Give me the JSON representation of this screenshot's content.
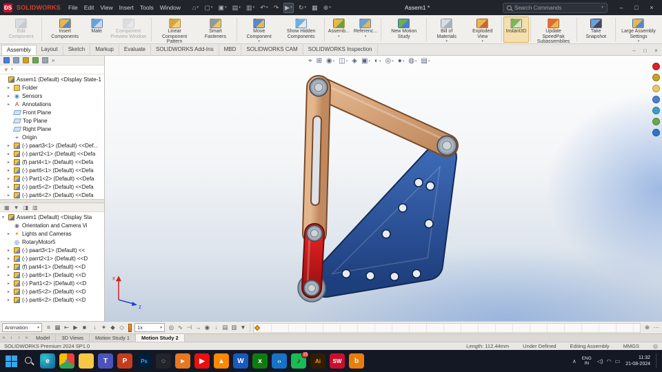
{
  "colors": {
    "brand_red": "#c8102e",
    "titlebar_bg": "#21252b",
    "link_tan": "#d4a07a",
    "plate_blue": "#2e549e",
    "link_red": "#cf1d1d",
    "pin_gray": "#9aa4b0",
    "instant3d_active_bg": "#f6dfae"
  },
  "titlebar": {
    "logo_text": "SOLIDWORKS",
    "menus": [
      "File",
      "Edit",
      "View",
      "Insert",
      "Tools",
      "Window"
    ],
    "quick_icons": [
      {
        "name": "home-icon",
        "glyph": "⌂",
        "caret": true
      },
      {
        "name": "new-document-icon",
        "glyph": "▢",
        "caret": true
      },
      {
        "name": "open-icon",
        "glyph": "▣",
        "caret": true
      },
      {
        "name": "save-icon",
        "glyph": "▤",
        "caret": true
      },
      {
        "name": "print-icon",
        "glyph": "▥",
        "caret": true
      },
      {
        "name": "undo-icon",
        "glyph": "↶",
        "caret": true
      },
      {
        "name": "redo-icon",
        "glyph": "↷"
      },
      {
        "name": "select-icon",
        "glyph": "▶",
        "caret": true,
        "selected": true
      },
      {
        "name": "rebuild-icon",
        "glyph": "↻",
        "caret": true
      },
      {
        "name": "file-properties-icon",
        "glyph": "▦"
      },
      {
        "name": "options-icon",
        "glyph": "⊛",
        "caret": true
      }
    ],
    "doc_title": "Assem1 *",
    "search_placeholder": "Search Commands",
    "search_caret": "▾",
    "window_controls": [
      {
        "name": "minimize-button",
        "glyph": "–"
      },
      {
        "name": "maximize-button",
        "glyph": "□"
      },
      {
        "name": "close-button",
        "glyph": "×"
      }
    ]
  },
  "ribbon": {
    "buttons": [
      {
        "label": "Edit Component",
        "icon": "edit-component-icon",
        "icon_colors": [
          "#b8c4d0",
          "#8898a8"
        ],
        "disabled": true,
        "sep": true
      },
      {
        "label": "Insert Components",
        "icon": "insert-components-icon",
        "icon_colors": [
          "#e8b84b",
          "#5a87c8"
        ]
      },
      {
        "label": "Mate",
        "icon": "mate-icon",
        "icon_colors": [
          "#68a0d8",
          "#c8d8ec"
        ]
      },
      {
        "label": "Component Preview Window",
        "icon": "component-preview-icon",
        "icon_colors": [
          "#b8c4d0",
          "#d8e0e8"
        ],
        "disabled": true,
        "sep": true
      },
      {
        "label": "Linear Component Pattern",
        "icon": "linear-pattern-icon",
        "icon_colors": [
          "#d8a43c",
          "#f0d080"
        ],
        "caret": true
      },
      {
        "label": "Smart Fasteners",
        "icon": "smart-fasteners-icon",
        "icon_colors": [
          "#9098a8",
          "#e8c860"
        ],
        "sep": true
      },
      {
        "label": "Move Component",
        "icon": "move-component-icon",
        "icon_colors": [
          "#5a87c8",
          "#e8b84b"
        ],
        "caret": true
      },
      {
        "label": "Show Hidden Components",
        "icon": "show-hidden-icon",
        "icon_colors": [
          "#70b0e0",
          "#e8e8e8"
        ],
        "sep": true
      },
      {
        "label": "Assemb...",
        "icon": "assembly-features-icon",
        "icon_colors": [
          "#e8b84b",
          "#68a048"
        ],
        "caret": true
      },
      {
        "label": "Referenc...",
        "icon": "reference-geometry-icon",
        "icon_colors": [
          "#68a0d8",
          "#e8b84b"
        ],
        "caret": true,
        "sep": true
      },
      {
        "label": "New Motion Study",
        "icon": "new-motion-study-icon",
        "icon_colors": [
          "#6ab04c",
          "#4a7fd4"
        ],
        "sep": true
      },
      {
        "label": "Bill of Materials",
        "icon": "bill-of-materials-icon",
        "icon_colors": [
          "#d8dce0",
          "#a8b0b8"
        ],
        "caret": true
      },
      {
        "label": "Exploded View",
        "icon": "exploded-view-icon",
        "icon_colors": [
          "#e8b84b",
          "#c86830"
        ],
        "caret": true,
        "sep": true
      },
      {
        "label": "Instant3D",
        "icon": "instant3d-icon",
        "icon_colors": [
          "#78b858",
          "#d8e0c8"
        ],
        "active": true,
        "sep": true
      },
      {
        "label": "Update SpeedPak Subassemblies",
        "icon": "update-speedpak-icon",
        "icon_colors": [
          "#e86830",
          "#e8b84b"
        ],
        "sep": true
      },
      {
        "label": "Take Snapshot",
        "icon": "take-snapshot-icon",
        "icon_colors": [
          "#68a0d8",
          "#404858"
        ],
        "sep": true
      },
      {
        "label": "Large Assembly Settings",
        "icon": "large-assembly-icon",
        "icon_colors": [
          "#e8b84b",
          "#5a87c8"
        ],
        "caret": true
      }
    ]
  },
  "tabs": {
    "items": [
      "Assembly",
      "Layout",
      "Sketch",
      "Markup",
      "Evaluate",
      "SOLIDWORKS Add-Ins",
      "MBD",
      "SOLIDWORKS CAM",
      "SOLIDWORKS Inspection"
    ],
    "active_index": 0,
    "doc_window_controls": [
      {
        "name": "doc-minimize-button",
        "glyph": "–"
      },
      {
        "name": "doc-restore-button",
        "glyph": "□"
      },
      {
        "name": "doc-close-button",
        "glyph": "×"
      }
    ]
  },
  "feature_manager": {
    "toolbar_icons": [
      {
        "name": "featuremanager-tree-icon",
        "color": "#4a7fd4"
      },
      {
        "name": "propertymanager-icon",
        "color": "#8aa0b8"
      },
      {
        "name": "configurationmanager-icon",
        "color": "#c9a227"
      },
      {
        "name": "dimxpertmanager-icon",
        "color": "#6aa84f"
      },
      {
        "name": "displaymanager-icon",
        "color": "#9aa4ae"
      },
      {
        "name": "panel-expand-icon",
        "glyph": "»"
      }
    ],
    "filter_icon": "▼",
    "filter_caret": "▾",
    "tree": [
      {
        "label": "Assem1 (Default) <Display State-1",
        "icon": "assembly",
        "exp": "",
        "d": 0
      },
      {
        "label": "Folder",
        "icon": "folder",
        "exp": "▸",
        "d": 1
      },
      {
        "label": "Sensors",
        "icon": "sensors",
        "exp": "▸",
        "d": 1
      },
      {
        "label": "Annotations",
        "icon": "annotations",
        "exp": "▸",
        "d": 1
      },
      {
        "label": "Front Plane",
        "icon": "plane",
        "exp": "",
        "d": 1
      },
      {
        "label": "Top Plane",
        "icon": "plane",
        "exp": "",
        "d": 1
      },
      {
        "label": "Right Plane",
        "icon": "plane",
        "exp": "",
        "d": 1
      },
      {
        "label": "Origin",
        "icon": "origin",
        "exp": "",
        "d": 1
      },
      {
        "label": "(-) paart3<1> (Default) <<Def...",
        "icon": "part",
        "exp": "▸",
        "d": 1
      },
      {
        "label": "(-) parrt2<1> (Default) <<Defa",
        "icon": "part",
        "exp": "▸",
        "d": 1
      },
      {
        "label": "(f) part4<1> (Default) <<Defa",
        "icon": "part",
        "exp": "▸",
        "d": 1
      },
      {
        "label": "(-) part6<1> (Default) <<Defa",
        "icon": "part",
        "exp": "▸",
        "d": 1
      },
      {
        "label": "(-) Part1<2> (Default) <<Defa",
        "icon": "part",
        "exp": "▸",
        "d": 1
      },
      {
        "label": "(-) part5<2> (Default) <<Defa",
        "icon": "part",
        "exp": "▸",
        "d": 1
      },
      {
        "label": "(-) part6<2> (Default) <<Defa",
        "icon": "part",
        "exp": "▸",
        "d": 1
      }
    ]
  },
  "motion_tree": {
    "header_icons": [
      {
        "name": "mm-filter-all-icon",
        "glyph": "▦"
      },
      {
        "name": "mm-filter-animated-icon",
        "glyph": "▼"
      },
      {
        "name": "mm-filter-driving-icon",
        "glyph": "◨"
      },
      {
        "name": "mm-filter-results-icon",
        "glyph": "▥"
      }
    ],
    "tree": [
      {
        "label": "Assem1 (Default) <Display Sta",
        "icon": "assembly",
        "exp": "▾",
        "d": 0
      },
      {
        "label": "Orientation and Camera Vi",
        "icon": "camera",
        "exp": "",
        "d": 1
      },
      {
        "label": "Lights and Cameras",
        "icon": "lights",
        "exp": "▸",
        "d": 1
      },
      {
        "label": "RotaryMotor5",
        "icon": "motor",
        "exp": "",
        "d": 1
      },
      {
        "label": "(-) paart3<1> (Default) <<",
        "icon": "part",
        "exp": "▸",
        "d": 1
      },
      {
        "label": "(-) parrt2<1> (Default) <<D",
        "icon": "part",
        "exp": "▸",
        "d": 1
      },
      {
        "label": "(f) part4<1> (Default) <<D",
        "icon": "part",
        "exp": "▸",
        "d": 1
      },
      {
        "label": "(-) part6<1> (Default) <<D",
        "icon": "part",
        "exp": "▸",
        "d": 1
      },
      {
        "label": "(-) Part1<2> (Default) <<D",
        "icon": "part",
        "exp": "▸",
        "d": 1
      },
      {
        "label": "(-) part5<2> (Default) <<D",
        "icon": "part",
        "exp": "▸",
        "d": 1
      },
      {
        "label": "(-) part6<2> (Default) <<D",
        "icon": "part",
        "exp": "▸",
        "d": 1
      }
    ]
  },
  "viewport": {
    "hud_icons": [
      {
        "name": "zoom-fit-icon",
        "glyph": "⌖"
      },
      {
        "name": "zoom-area-icon",
        "glyph": "⊞"
      },
      {
        "name": "previous-view-icon",
        "glyph": "◉",
        "caret": true
      },
      {
        "name": "section-view-icon",
        "glyph": "◫",
        "caret": true
      },
      {
        "name": "dynamic-annotation-icon",
        "glyph": "◈"
      },
      {
        "name": "view-orientation-icon",
        "glyph": "▣",
        "caret": true
      },
      {
        "name": "display-style-icon",
        "glyph": "◐",
        "caret": true
      },
      {
        "name": "hide-show-items-icon",
        "glyph": "◎",
        "caret": true
      },
      {
        "name": "edit-appearance-icon",
        "glyph": "●",
        "caret": true
      },
      {
        "name": "apply-scene-icon",
        "glyph": "◍",
        "caret": true
      },
      {
        "name": "view-settings-icon",
        "glyph": "▤",
        "caret": true
      }
    ],
    "triad": {
      "x_label": "x",
      "z_label": "z"
    },
    "task_pane_icons": [
      {
        "name": "solidworks-resources-icon",
        "color": "#d42828"
      },
      {
        "name": "design-library-icon",
        "color": "#c9a227"
      },
      {
        "name": "file-explorer-icon",
        "color": "#e8c860"
      },
      {
        "name": "view-palette-icon",
        "color": "#4a7fd4"
      },
      {
        "name": "appearances-icon",
        "color": "#3ba0c8"
      },
      {
        "name": "custom-properties-icon",
        "color": "#6aa84f"
      },
      {
        "name": "forum-icon",
        "color": "#2e74c8"
      }
    ]
  },
  "model": {
    "parts": [
      {
        "name": "blue-plate",
        "color": "#2e549e"
      },
      {
        "name": "tan-link-diagonal",
        "color": "#d4a07a"
      },
      {
        "name": "tan-link-vertical",
        "color": "#d4a07a"
      },
      {
        "name": "red-link",
        "color": "#cf1d1d"
      },
      {
        "name": "pins",
        "color": "#9aa4b0"
      }
    ]
  },
  "motion_toolbar": {
    "animation_label": "Animation",
    "caret_glyph": "▾",
    "icons_a": [
      {
        "name": "motionmanager-toggle-icon",
        "glyph": "≡"
      },
      {
        "name": "calculate-icon",
        "glyph": "▦"
      },
      {
        "name": "play-from-start-icon",
        "glyph": "⇤"
      },
      {
        "name": "play-icon",
        "glyph": "▶"
      },
      {
        "name": "stop-icon",
        "glyph": "■"
      }
    ],
    "icons_b": [
      {
        "name": "save-animation-icon",
        "glyph": "↓"
      },
      {
        "name": "animation-wizard-icon",
        "glyph": "✦"
      },
      {
        "name": "autokey-icon",
        "glyph": "◆"
      },
      {
        "name": "add-key-icon",
        "glyph": "◇"
      }
    ],
    "speed_value": "1x",
    "icons_c": [
      {
        "name": "motor-icon",
        "glyph": "◎"
      },
      {
        "name": "spring-icon",
        "glyph": "∿"
      },
      {
        "name": "damper-icon",
        "glyph": "⊣"
      },
      {
        "name": "force-icon",
        "glyph": "→"
      },
      {
        "name": "contact-icon",
        "glyph": "◉"
      },
      {
        "name": "gravity-icon",
        "glyph": "↓"
      },
      {
        "name": "results-icon",
        "glyph": "▤"
      },
      {
        "name": "chart-icon",
        "glyph": "▥"
      },
      {
        "name": "filters-icon",
        "glyph": "▼"
      }
    ],
    "right_icons": [
      {
        "name": "zoom-timeline-icon",
        "glyph": "⊕"
      },
      {
        "name": "timeline-options-icon",
        "glyph": "⋯"
      }
    ]
  },
  "doc_tabs": {
    "nav_icons": [
      "«",
      "‹",
      "›",
      "»"
    ],
    "items": [
      "Model",
      "3D Views",
      "Motion Study 1",
      "Motion Study 2"
    ],
    "active_index": 3
  },
  "statusbar": {
    "left": "SOLIDWORKS Premium 2024 SP1.0",
    "items": [
      "Length: 112.44mm",
      "Under Defined",
      "Editing Assembly",
      "MMGS"
    ],
    "units_icon": "◎"
  },
  "taskbar": {
    "apps": [
      {
        "name": "edge",
        "glyph": "e",
        "fg": "#ffffff",
        "bg": "radial-gradient(circle at 30% 30%, #35c1c4, #0b61a4)"
      },
      {
        "name": "chrome",
        "glyph": "●",
        "fg": "#4285f4",
        "bg": "conic-gradient(#ea4335 0deg 120deg, #34a853 120deg 240deg, #fbbc05 240deg 360deg)"
      },
      {
        "name": "file-explorer",
        "glyph": "",
        "fg": "#ffffff",
        "bg": "#f6c844"
      },
      {
        "name": "teams",
        "glyph": "T",
        "fg": "#ffffff",
        "bg": "#4b53bc"
      },
      {
        "name": "powerpoint",
        "glyph": "P",
        "fg": "#ffffff",
        "bg": "#c43e1c"
      },
      {
        "name": "photoshop",
        "glyph": "Ps",
        "fg": "#31a8ff",
        "bg": "#001e36"
      },
      {
        "name": "obs",
        "glyph": "◌",
        "fg": "#ffffff",
        "bg": "#22242a"
      },
      {
        "name": "media-player",
        "glyph": "▸",
        "fg": "#ffffff",
        "bg": "#e87722"
      },
      {
        "name": "youtube",
        "glyph": "▶",
        "fg": "#ffffff",
        "bg": "#e81010"
      },
      {
        "name": "vlc",
        "glyph": "▲",
        "fg": "#ffffff",
        "bg": "#ff8800"
      },
      {
        "name": "word",
        "glyph": "W",
        "fg": "#ffffff",
        "bg": "#185abd"
      },
      {
        "name": "xbox",
        "glyph": "x",
        "fg": "#ffffff",
        "bg": "#107c10"
      },
      {
        "name": "vscode",
        "glyph": "‹›",
        "fg": "#ffffff",
        "bg": "#1673c6"
      },
      {
        "name": "spotify",
        "glyph": "♪",
        "fg": "#0a0a0a",
        "bg": "#1db954",
        "badge": "15"
      },
      {
        "name": "illustrator",
        "glyph": "Ai",
        "fg": "#ff9a00",
        "bg": "#331c00"
      },
      {
        "name": "solidworks",
        "glyph": "SW",
        "fg": "#ffffff",
        "bg": "#c8102e"
      },
      {
        "name": "blender",
        "glyph": "b",
        "fg": "#ffffff",
        "bg": "#e87d0d"
      }
    ],
    "tray": {
      "caret": "∧",
      "icons": [
        {
          "name": "speaker-icon",
          "glyph": "◁)"
        },
        {
          "name": "network-icon",
          "glyph": "◠"
        },
        {
          "name": "battery-icon",
          "glyph": "▭"
        }
      ],
      "lang_line1": "ENG",
      "lang_line2": "IN",
      "time": "11:32",
      "date": "21-08-2024"
    }
  }
}
